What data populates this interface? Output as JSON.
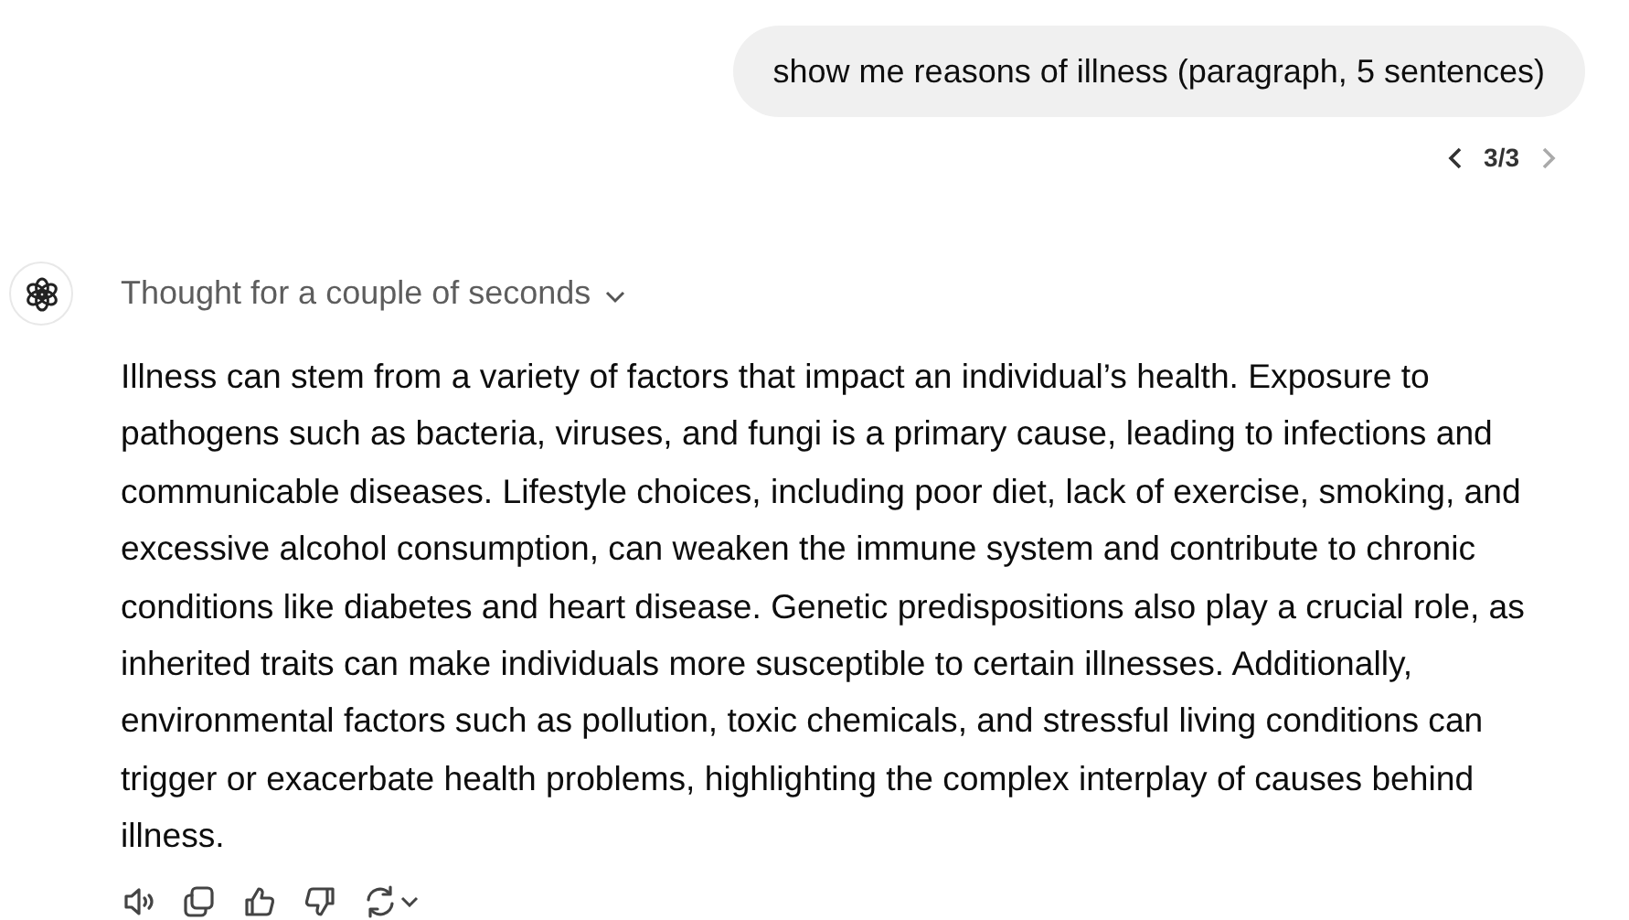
{
  "user_message": {
    "text": "show me reasons of illness (paragraph, 5 sentences)"
  },
  "pager": {
    "label": "3/3",
    "previous": {
      "disabled": false
    },
    "next": {
      "disabled": true
    }
  },
  "reply": {
    "thought": "Thought for a couple of seconds",
    "expanded": false,
    "paragraph": "Illness can stem from a variety of factors that impact an individual’s health. Exposure to pathogens such as bacteria, viruses, and fungi is a primary cause, leading to infections and communicable diseases. Lifestyle choices, including poor diet, lack of exercise, smoking, and excessive alcohol consumption, can weaken the immune system and contribute to chronic conditions like diabetes and heart disease. Genetic predispositions also play a crucial role, as inherited traits can make individuals more susceptible to certain illnesses. Additionally, environmental factors such as pollution, toxic chemicals, and stressful living conditions can trigger or exacerbate health problems, highlighting the complex interplay of causes behind illness."
  },
  "actions": [
    {
      "kind": "speaker"
    },
    {
      "kind": "copy"
    },
    {
      "kind": "thumbs-up"
    },
    {
      "kind": "thumbs-down"
    },
    {
      "kind": "regenerate"
    }
  ]
}
